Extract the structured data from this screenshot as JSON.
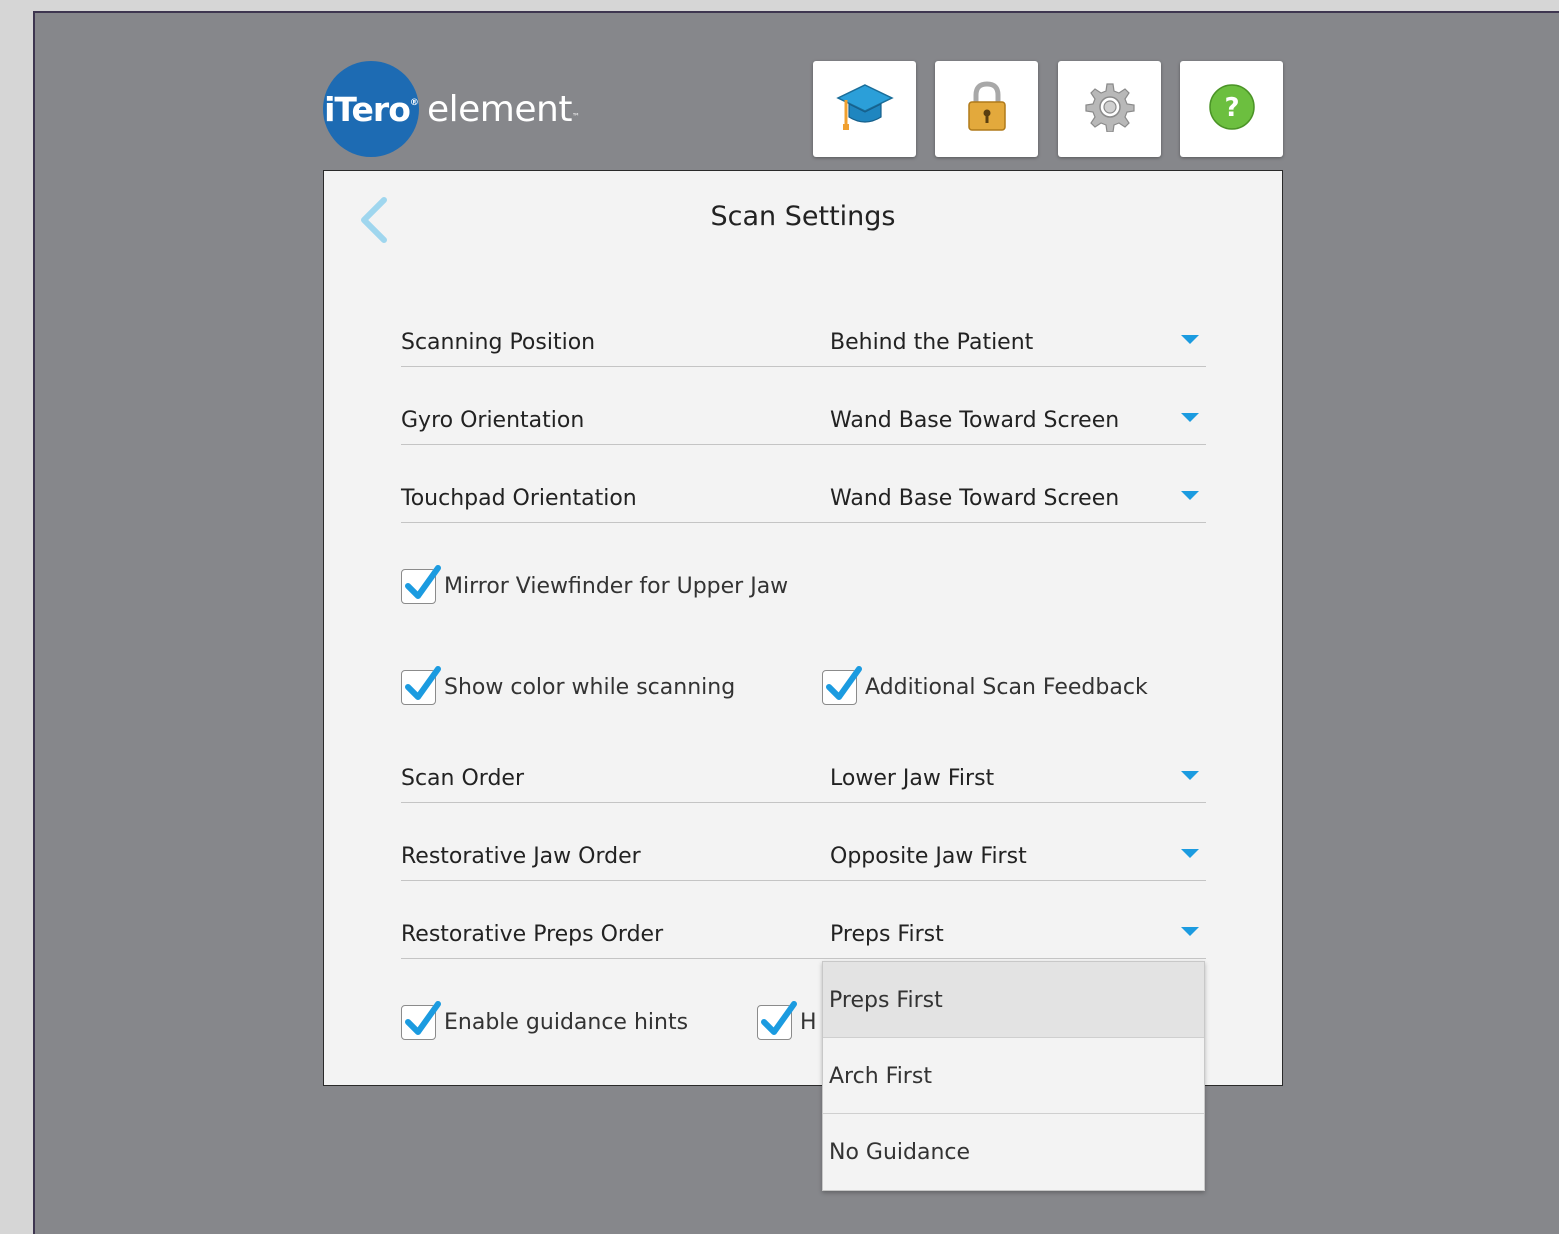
{
  "logo": {
    "brand": "iTero",
    "registered": "®",
    "product": "element",
    "tm": "™"
  },
  "toolbar": {
    "learn_icon": "graduation-cap-icon",
    "lock_icon": "padlock-icon",
    "settings_icon": "gear-icon",
    "help_icon": "help-icon",
    "help_glyph": "?"
  },
  "panel": {
    "title": "Scan Settings",
    "back_icon": "chevron-left-icon"
  },
  "settings": {
    "scanning_position": {
      "label": "Scanning Position",
      "value": "Behind the Patient"
    },
    "gyro_orientation": {
      "label": "Gyro Orientation",
      "value": "Wand Base Toward Screen"
    },
    "touchpad_orientation": {
      "label": "Touchpad Orientation",
      "value": "Wand Base Toward Screen"
    },
    "scan_order": {
      "label": "Scan Order",
      "value": "Lower Jaw First"
    },
    "restorative_jaw_order": {
      "label": "Restorative Jaw Order",
      "value": "Opposite Jaw First"
    },
    "restorative_preps_order": {
      "label": "Restorative Preps Order",
      "value": "Preps First"
    }
  },
  "checkboxes": {
    "mirror_viewfinder": {
      "label": "Mirror Viewfinder for Upper Jaw",
      "checked": true
    },
    "show_color": {
      "label": "Show color while scanning",
      "checked": true
    },
    "additional_feedback": {
      "label": "Additional Scan Feedback",
      "checked": true
    },
    "guidance_hints": {
      "label": "Enable guidance hints",
      "checked": true
    },
    "partially_hidden": {
      "label": "H",
      "checked": true
    }
  },
  "dropdown": {
    "options": [
      "Preps First",
      "Arch First",
      "No Guidance"
    ],
    "selected": "Preps First"
  },
  "colors": {
    "accent": "#1b9be0",
    "logo_blue": "#1d6bb3",
    "background": "#86878b",
    "panel": "#f3f3f3",
    "help_green": "#6cbf3f"
  }
}
